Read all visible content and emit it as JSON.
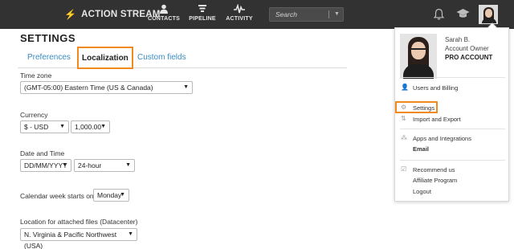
{
  "app": {
    "brand": "ACTION STREAM",
    "nav": [
      {
        "label": "CONTACTS",
        "icon": "person-icon"
      },
      {
        "label": "PIPELINE",
        "icon": "filter-icon"
      },
      {
        "label": "ACTIVITY",
        "icon": "pulse-icon"
      }
    ],
    "search_placeholder": "Search"
  },
  "page": {
    "title": "SETTINGS",
    "tabs": [
      {
        "label": "Preferences",
        "active": false
      },
      {
        "label": "Localization",
        "active": true
      },
      {
        "label": "Custom fields",
        "active": false
      }
    ],
    "fields": {
      "timezone_label": "Time zone",
      "timezone_value": "(GMT-05:00) Eastern Time (US & Canada)",
      "currency_label": "Currency",
      "currency_value": "$ - USD",
      "number_format_value": "1,000.00",
      "datetime_label": "Date and Time",
      "date_format_value": "DD/MM/YYYY",
      "time_format_value": "24-hour",
      "week_start_label": "Calendar week starts on",
      "week_start_value": "Monday",
      "location_label": "Location for attached files (Datacenter)",
      "location_value": "N. Virginia & Pacific Northwest (USA)"
    }
  },
  "user_menu": {
    "name": "Sarah B.",
    "role": "Account Owner",
    "account": "PRO ACCOUNT",
    "items": {
      "users_billing": "Users and Billing",
      "settings": "Settings",
      "import_export": "Import and Export",
      "apps": "Apps and Integrations",
      "email": "Email",
      "recommend": "Recommend us",
      "affiliate": "Affiliate Program",
      "logout": "Logout"
    }
  },
  "colors": {
    "topbar": "#323232",
    "accent_highlight": "#f08a1c",
    "tab_link": "#3a8dc4"
  }
}
